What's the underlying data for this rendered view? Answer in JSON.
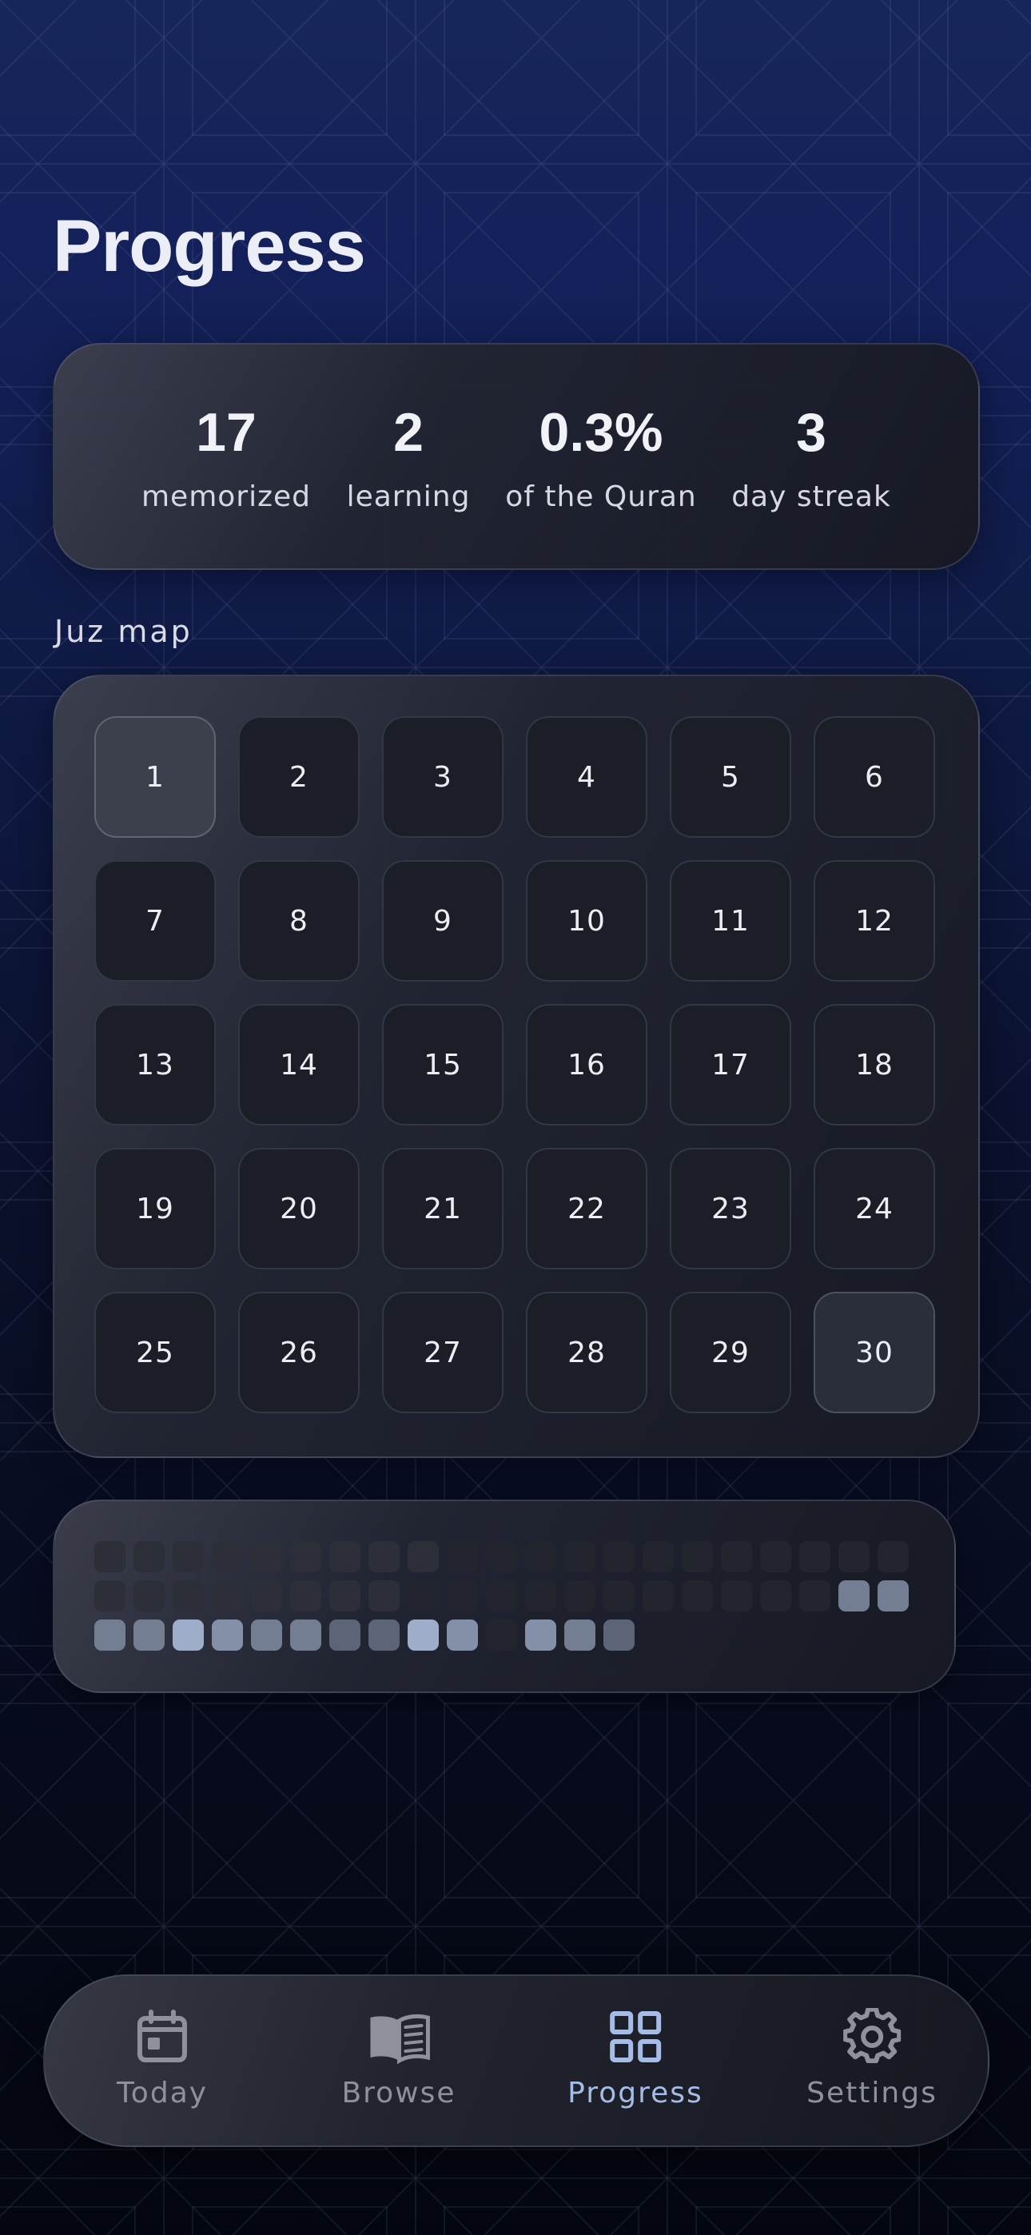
{
  "header": {
    "title": "Progress"
  },
  "stats": [
    {
      "value": "17",
      "label": "memorized"
    },
    {
      "value": "2",
      "label": "learning"
    },
    {
      "value": "0.3%",
      "label": "of the Quran"
    },
    {
      "value": "3",
      "label": "day streak"
    }
  ],
  "juz_section": {
    "label": "Juz map"
  },
  "juz_map": [
    {
      "label": "1",
      "state": "highlight"
    },
    {
      "label": "2",
      "state": "default"
    },
    {
      "label": "3",
      "state": "default"
    },
    {
      "label": "4",
      "state": "default"
    },
    {
      "label": "5",
      "state": "default"
    },
    {
      "label": "6",
      "state": "default"
    },
    {
      "label": "7",
      "state": "default"
    },
    {
      "label": "8",
      "state": "default"
    },
    {
      "label": "9",
      "state": "default"
    },
    {
      "label": "10",
      "state": "default"
    },
    {
      "label": "11",
      "state": "default"
    },
    {
      "label": "12",
      "state": "default"
    },
    {
      "label": "13",
      "state": "default"
    },
    {
      "label": "14",
      "state": "default"
    },
    {
      "label": "15",
      "state": "default"
    },
    {
      "label": "16",
      "state": "default"
    },
    {
      "label": "17",
      "state": "default"
    },
    {
      "label": "18",
      "state": "default"
    },
    {
      "label": "19",
      "state": "default"
    },
    {
      "label": "20",
      "state": "default"
    },
    {
      "label": "21",
      "state": "default"
    },
    {
      "label": "22",
      "state": "default"
    },
    {
      "label": "23",
      "state": "default"
    },
    {
      "label": "24",
      "state": "default"
    },
    {
      "label": "25",
      "state": "default"
    },
    {
      "label": "26",
      "state": "default"
    },
    {
      "label": "27",
      "state": "default"
    },
    {
      "label": "28",
      "state": "default"
    },
    {
      "label": "29",
      "state": "default"
    },
    {
      "label": "30",
      "state": "partial"
    }
  ],
  "activity_heatmap": {
    "levels": [
      1,
      1,
      1,
      1,
      1,
      1,
      1,
      1,
      1,
      0,
      0,
      0,
      0,
      0,
      0,
      0,
      0,
      0,
      0,
      0,
      0,
      1,
      1,
      1,
      1,
      1,
      1,
      1,
      1,
      0,
      0,
      0,
      0,
      0,
      0,
      0,
      0,
      0,
      0,
      0,
      3,
      3,
      3,
      3,
      5,
      4,
      3,
      3,
      2,
      2,
      5,
      4,
      0,
      4,
      3,
      2,
      -1,
      -1,
      -1,
      -1,
      -1,
      -1,
      -1
    ],
    "colors": {
      "-1": "transparent",
      "0": "#22242e",
      "1": "#2c2e38",
      "2": "#5c6477",
      "3": "#747e93",
      "4": "#8390a8",
      "5": "#9eadc8"
    }
  },
  "tab_bar": {
    "items": [
      {
        "label": "Today",
        "icon": "calendar-icon",
        "active": false
      },
      {
        "label": "Browse",
        "icon": "book-icon",
        "active": false
      },
      {
        "label": "Progress",
        "icon": "grid-icon",
        "active": true
      },
      {
        "label": "Settings",
        "icon": "gear-icon",
        "active": false
      }
    ],
    "active_color": "#a5bde6",
    "inactive_color": "#8e919c"
  }
}
